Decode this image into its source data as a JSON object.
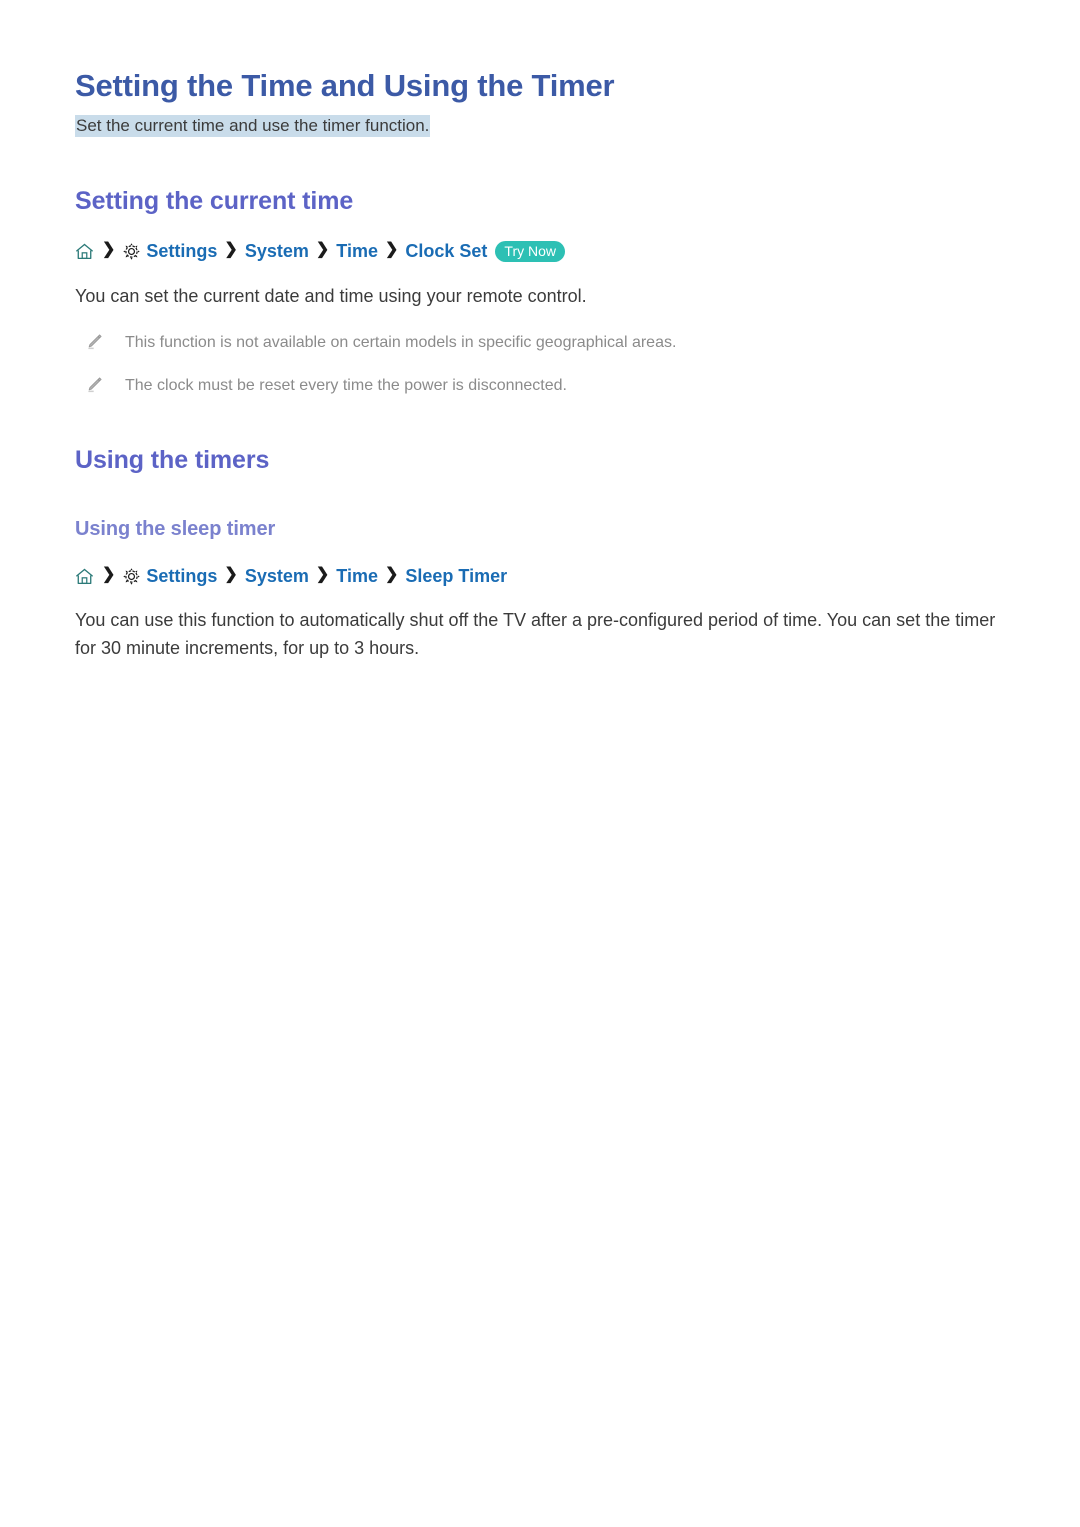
{
  "document": {
    "title": "Setting the Time and Using the Timer",
    "subtitle": "Set the current time and use the timer function."
  },
  "icons": {
    "home": "home-icon",
    "gear": "gear-icon",
    "pencil": "pencil-icon",
    "chevron": "chevron-right-icon"
  },
  "colors": {
    "h1": "#3c5aa6",
    "h2": "#5c63c6",
    "h3": "#7b82ce",
    "link": "#1a6cb4",
    "highlight": "#c9dcea",
    "badge": "#2dc0b4",
    "body": "#3b3b3b",
    "note": "#8b8b8b"
  },
  "sections": [
    {
      "heading": "Setting the current time",
      "path": {
        "separator": "❯",
        "crumbs": [
          "Settings",
          "System",
          "Time",
          "Clock Set"
        ],
        "badge": "Try Now"
      },
      "paragraph": "You can set the current date and time using your remote control.",
      "notes": [
        "This function is not available on certain models in specific geographical areas.",
        "The clock must be reset every time the power is disconnected."
      ]
    },
    {
      "heading": "Using the timers",
      "subheading": "Using the sleep timer",
      "path": {
        "separator": "❯",
        "crumbs": [
          "Settings",
          "System",
          "Time",
          "Sleep Timer"
        ]
      },
      "paragraph": "You can use this function to automatically shut off the TV after a pre-configured period of time. You can set the timer for 30 minute increments, for up to 3 hours."
    }
  ]
}
